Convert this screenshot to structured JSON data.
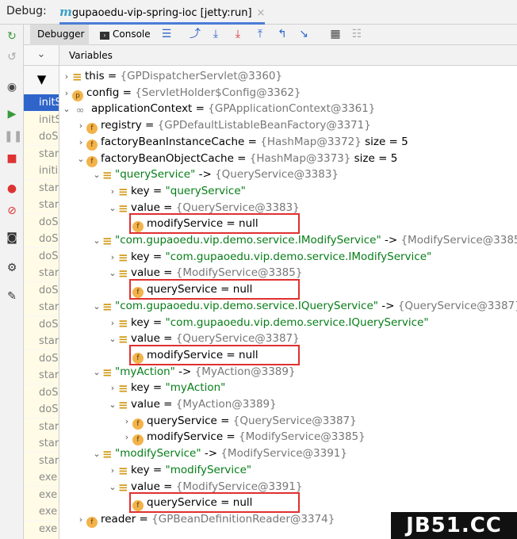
{
  "title_bar": {
    "debug_label": "Debug:",
    "session_tab": "gupaoedu-vip-spring-ioc [jetty:run]",
    "session_icon": "m",
    "close": "×"
  },
  "toolbar": {
    "debugger_tab": "Debugger",
    "console_tab": "Console"
  },
  "variables_header": "Variables",
  "frames": [
    "initS",
    "initS",
    "doS",
    "star",
    "initi",
    "star",
    "star",
    "doS",
    "doS",
    "doS",
    "star",
    "doS",
    "star",
    "doS",
    "star",
    "doS",
    "star",
    "doS",
    "doS",
    "star",
    "star",
    "star",
    "exe",
    "exe",
    "exe",
    "exe",
    "exe"
  ],
  "tree": [
    {
      "name": "this",
      "eq": " = ",
      "val": "{GPDispatcherServlet@3360}"
    },
    {
      "name": "config",
      "eq": " = ",
      "val": "{ServletHolder$Config@3362}"
    },
    {
      "name": "applicationContext",
      "eq": " = ",
      "val": "{GPApplicationContext@3361}"
    },
    {
      "name": "registry",
      "eq": " = ",
      "val": "{GPDefaultListableBeanFactory@3371}"
    },
    {
      "name": "factoryBeanInstanceCache",
      "eq": " = ",
      "val": "{HashMap@3372}",
      "extra": " size = 5"
    },
    {
      "name": "factoryBeanObjectCache",
      "eq": " = ",
      "val": "{HashMap@3373}",
      "extra": " size = 5"
    },
    {
      "name": "\"queryService\"",
      "eq": " -> ",
      "val": "{QueryService@3383}"
    },
    {
      "name": "key",
      "eq": " = ",
      "val": "\"queryService\""
    },
    {
      "name": "value",
      "eq": " = ",
      "val": "{QueryService@3383}"
    },
    {
      "name": "modifyService",
      "eq": " = ",
      "val": "null"
    },
    {
      "name": "\"com.gupaoedu.vip.demo.service.IModifyService\"",
      "eq": " -> ",
      "val": "{ModifyService@3385}"
    },
    {
      "name": "key",
      "eq": " = ",
      "val": "\"com.gupaoedu.vip.demo.service.IModifyService\""
    },
    {
      "name": "value",
      "eq": " = ",
      "val": "{ModifyService@3385}"
    },
    {
      "name": "queryService",
      "eq": " = ",
      "val": "null"
    },
    {
      "name": "\"com.gupaoedu.vip.demo.service.IQueryService\"",
      "eq": " -> ",
      "val": "{QueryService@3387}"
    },
    {
      "name": "key",
      "eq": " = ",
      "val": "\"com.gupaoedu.vip.demo.service.IQueryService\""
    },
    {
      "name": "value",
      "eq": " = ",
      "val": "{QueryService@3387}"
    },
    {
      "name": "modifyService",
      "eq": " = ",
      "val": "null"
    },
    {
      "name": "\"myAction\"",
      "eq": " -> ",
      "val": "{MyAction@3389}"
    },
    {
      "name": "key",
      "eq": " = ",
      "val": "\"myAction\""
    },
    {
      "name": "value",
      "eq": " = ",
      "val": "{MyAction@3389}"
    },
    {
      "name": "queryService",
      "eq": " = ",
      "val": "{QueryService@3387}"
    },
    {
      "name": "modifyService",
      "eq": " = ",
      "val": "{ModifyService@3385}"
    },
    {
      "name": "\"modifyService\"",
      "eq": " -> ",
      "val": "{ModifyService@3391}"
    },
    {
      "name": "key",
      "eq": " = ",
      "val": "\"modifyService\""
    },
    {
      "name": "value",
      "eq": " = ",
      "val": "{ModifyService@3391}"
    },
    {
      "name": "queryService",
      "eq": " = ",
      "val": "null"
    },
    {
      "name": "reader",
      "eq": " = ",
      "val": "{GPBeanDefinitionReader@3374}"
    }
  ],
  "watermark": "JB51.CC"
}
